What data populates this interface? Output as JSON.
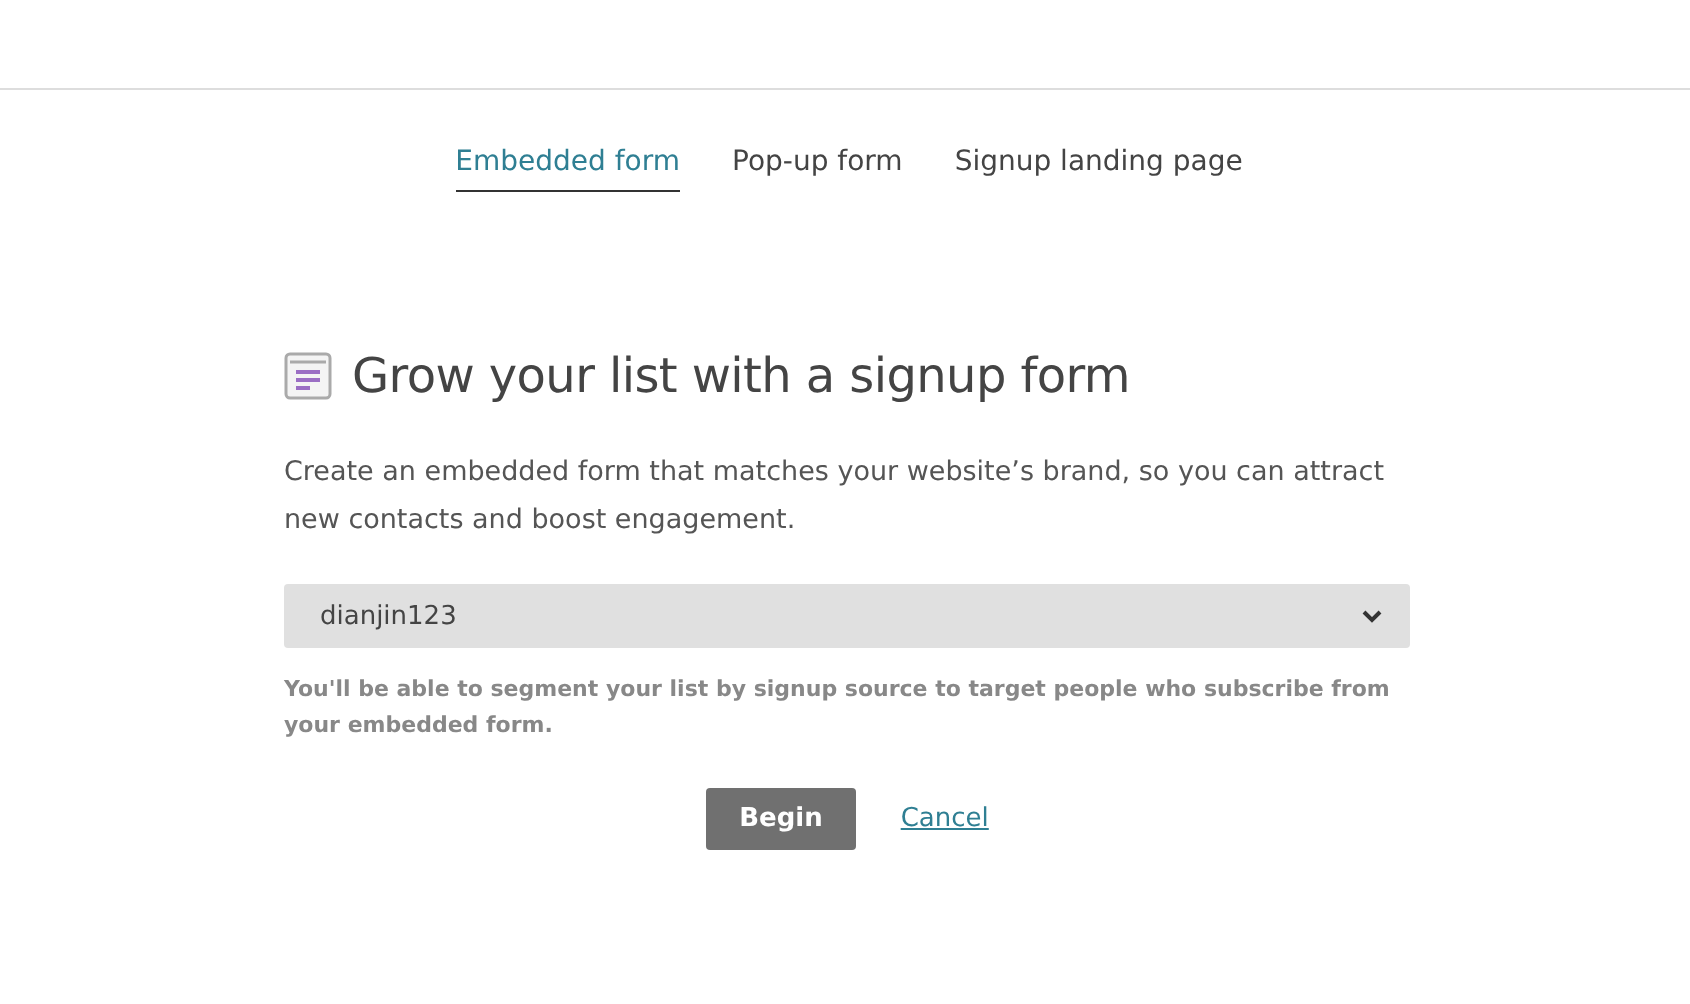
{
  "tabs": [
    {
      "label": "Embedded form",
      "selected": true
    },
    {
      "label": "Pop-up form",
      "selected": false
    },
    {
      "label": "Signup landing page",
      "selected": false
    }
  ],
  "heading": "Grow your list with a signup form",
  "description": "Create an embedded form that matches your website’s brand, so you can attract new contacts and boost engagement.",
  "list_select": {
    "value": "dianjin123"
  },
  "hint": "You'll be able to segment your list by signup source to target people who subscribe from your embedded form.",
  "buttons": {
    "primary": "Begin",
    "cancel": "Cancel"
  }
}
